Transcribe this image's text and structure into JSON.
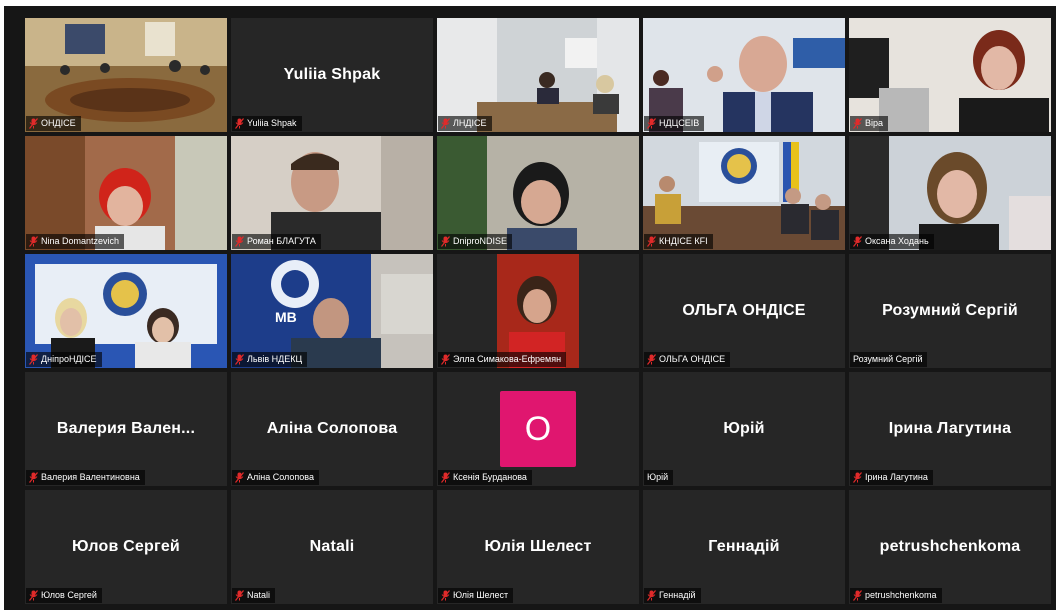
{
  "participants": [
    {
      "name": "ОНДІСЕ",
      "display": "",
      "muted": true,
      "type": "video",
      "scene": "conference",
      "active": true
    },
    {
      "name": "Yuliia Shpak",
      "display": "Yuliia Shpak",
      "muted": true,
      "type": "name"
    },
    {
      "name": "ЛНДІСЕ",
      "display": "",
      "muted": true,
      "type": "video",
      "scene": "office"
    },
    {
      "name": "НДЦСЕІВ",
      "display": "",
      "muted": true,
      "type": "video",
      "scene": "man"
    },
    {
      "name": "Віра",
      "display": "",
      "muted": true,
      "type": "video",
      "scene": "woman-blonde"
    },
    {
      "name": "Nina Domantzevich",
      "display": "",
      "muted": true,
      "type": "video",
      "scene": "woman-red"
    },
    {
      "name": "Роман БЛАГУТА",
      "display": "",
      "muted": true,
      "type": "video",
      "scene": "man-side"
    },
    {
      "name": "DniproNDISE",
      "display": "",
      "muted": true,
      "type": "video",
      "scene": "woman-dark"
    },
    {
      "name": "КНДІСЕ КFI",
      "display": "",
      "muted": true,
      "type": "video",
      "scene": "meeting"
    },
    {
      "name": "Оксана Ходань",
      "display": "",
      "muted": true,
      "type": "video",
      "scene": "woman-brown"
    },
    {
      "name": "ДніпроНДІСЕ",
      "display": "",
      "muted": true,
      "type": "video",
      "scene": "two-women"
    },
    {
      "name": "Львів НДЕКЦ",
      "display": "",
      "muted": true,
      "type": "video",
      "scene": "mvs"
    },
    {
      "name": "Элла Симакова-Ефремян",
      "display": "",
      "muted": true,
      "type": "video",
      "scene": "woman-red-bg"
    },
    {
      "name": "ОЛЬГА ОНДІСЕ",
      "display": "ОЛЬГА ОНДІСЕ",
      "muted": true,
      "type": "name"
    },
    {
      "name": "Розумний Сергій",
      "display": "Розумний Сергій",
      "muted": false,
      "type": "name"
    },
    {
      "name": "Валерия Валентиновна",
      "display": "Валерия  Вален...",
      "muted": true,
      "type": "name"
    },
    {
      "name": "Аліна Солопова",
      "display": "Аліна Солопова",
      "muted": true,
      "type": "name"
    },
    {
      "name": "Ксенія Бурданова",
      "display": "",
      "muted": true,
      "type": "avatar",
      "initial": "O",
      "avatar_color": "#e0166f"
    },
    {
      "name": "Юрій",
      "display": "Юрій",
      "muted": false,
      "type": "name"
    },
    {
      "name": "Ірина Лагутина",
      "display": "Ірина Лагутина",
      "muted": true,
      "type": "name"
    },
    {
      "name": "Юлов Сергей",
      "display": "Юлов Сергей",
      "muted": true,
      "type": "name"
    },
    {
      "name": "Natali",
      "display": "Natali",
      "muted": true,
      "type": "name"
    },
    {
      "name": "Юлія Шелест",
      "display": "Юлія Шелест",
      "muted": true,
      "type": "name"
    },
    {
      "name": "Геннадій",
      "display": "Геннадій",
      "muted": true,
      "type": "name"
    },
    {
      "name": "petrushchenkoma",
      "display": "petrushchenkoma",
      "muted": true,
      "type": "name"
    }
  ],
  "colors": {
    "background": "#161616",
    "tile": "#262626",
    "active_border": "#d8e04a",
    "muted_icon": "#e02a2a"
  },
  "icons": {
    "muted": "muted-mic-icon"
  }
}
